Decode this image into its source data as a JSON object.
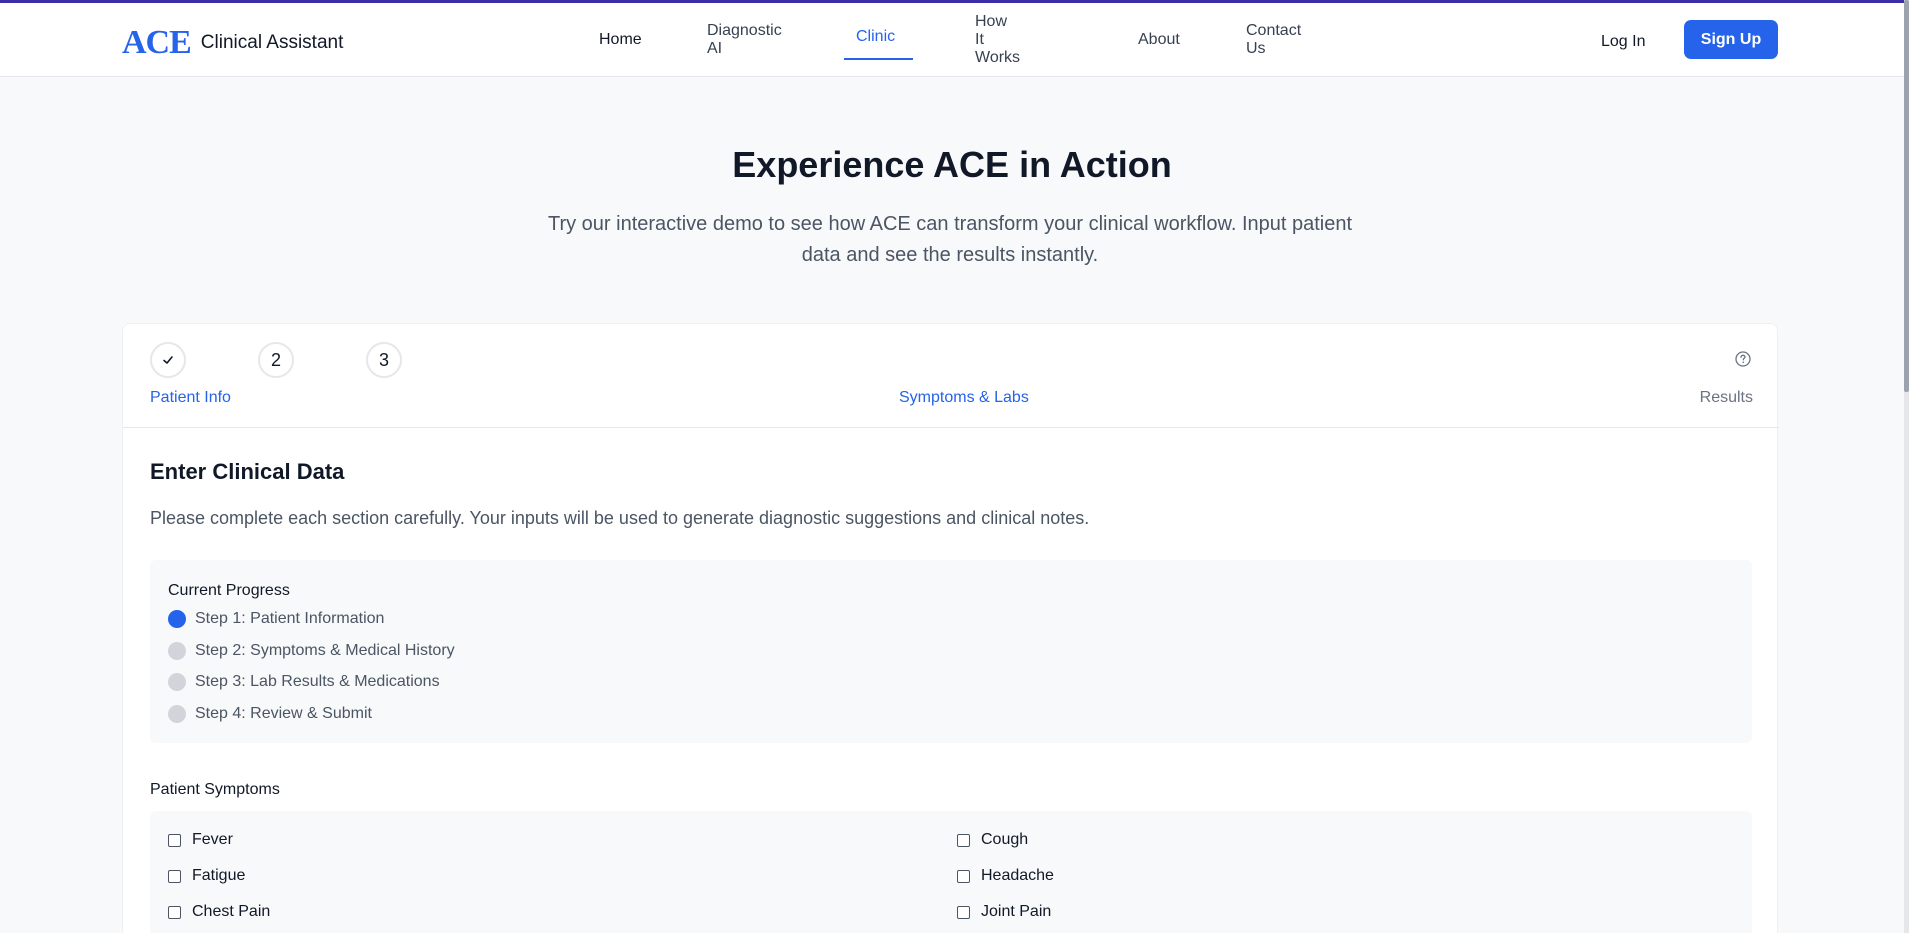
{
  "header": {
    "logo_text": "ACE",
    "brand_name": "Clinical Assistant",
    "nav": [
      "Home",
      "Diagnostic AI",
      "Clinic",
      "How It Works",
      "About",
      "Contact Us"
    ],
    "active_nav": "Clinic",
    "login_label": "Log In",
    "signup_label": "Sign Up"
  },
  "hero": {
    "title": "Experience ACE in Action",
    "subtitle": "Try our interactive demo to see how ACE can transform your clinical workflow. Input patient data and see the results instantly."
  },
  "stepper": {
    "steps": [
      {
        "number": "✓",
        "label": "Patient Info"
      },
      {
        "number": "2",
        "label": "Symptoms & Labs"
      },
      {
        "number": "3",
        "label": "Results"
      }
    ],
    "help_icon": "question-circle-icon"
  },
  "form": {
    "title": "Enter Clinical Data",
    "description": "Please complete each section carefully. Your inputs will be used to generate diagnostic suggestions and clinical notes.",
    "progress": {
      "title": "Current Progress",
      "steps": [
        "Step 1: Patient Information",
        "Step 2: Symptoms & Medical History",
        "Step 3: Lab Results & Medications",
        "Step 4: Review & Submit"
      ],
      "active_index": 0
    },
    "symptoms": {
      "title": "Patient Symptoms",
      "items": [
        "Fever",
        "Cough",
        "Fatigue",
        "Headache",
        "Chest Pain",
        "Joint Pain"
      ]
    }
  },
  "colors": {
    "accent": "#2563eb",
    "top_bar": "#3b2fa8"
  }
}
